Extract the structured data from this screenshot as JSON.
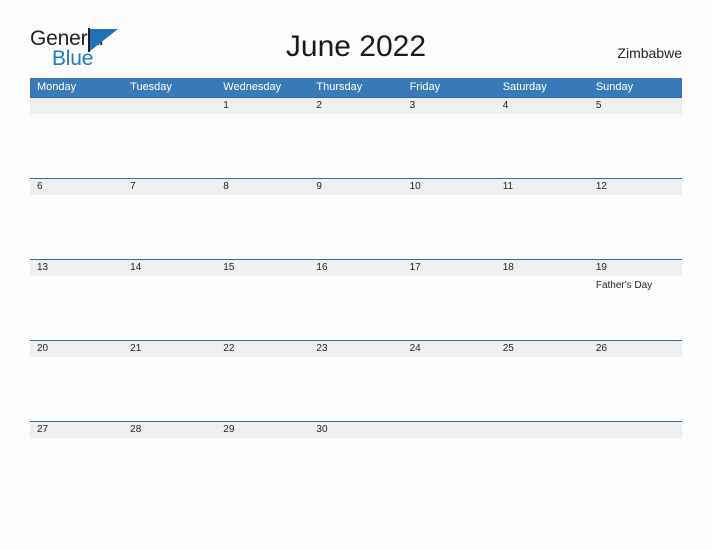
{
  "brand": {
    "name_part1": "General",
    "name_part2": "Blue",
    "triangle_color": "#2071b5",
    "blue_color": "#1f7bc1"
  },
  "header": {
    "title": "June 2022",
    "country": "Zimbabwe"
  },
  "theme": {
    "header_blue": "#3a7ab8",
    "band_gray": "#efefef",
    "band_border": "#2e6da4",
    "page_background": "#fcfcfc",
    "text_color": "#231f20"
  },
  "calendar": {
    "weekdays": [
      "Monday",
      "Tuesday",
      "Wednesday",
      "Thursday",
      "Friday",
      "Saturday",
      "Sunday"
    ],
    "weeks": [
      {
        "days": [
          {
            "date": "",
            "event": ""
          },
          {
            "date": "",
            "event": ""
          },
          {
            "date": "1",
            "event": ""
          },
          {
            "date": "2",
            "event": ""
          },
          {
            "date": "3",
            "event": ""
          },
          {
            "date": "4",
            "event": ""
          },
          {
            "date": "5",
            "event": ""
          }
        ]
      },
      {
        "days": [
          {
            "date": "6",
            "event": ""
          },
          {
            "date": "7",
            "event": ""
          },
          {
            "date": "8",
            "event": ""
          },
          {
            "date": "9",
            "event": ""
          },
          {
            "date": "10",
            "event": ""
          },
          {
            "date": "11",
            "event": ""
          },
          {
            "date": "12",
            "event": ""
          }
        ]
      },
      {
        "days": [
          {
            "date": "13",
            "event": ""
          },
          {
            "date": "14",
            "event": ""
          },
          {
            "date": "15",
            "event": ""
          },
          {
            "date": "16",
            "event": ""
          },
          {
            "date": "17",
            "event": ""
          },
          {
            "date": "18",
            "event": ""
          },
          {
            "date": "19",
            "event": "Father's Day"
          }
        ]
      },
      {
        "days": [
          {
            "date": "20",
            "event": ""
          },
          {
            "date": "21",
            "event": ""
          },
          {
            "date": "22",
            "event": ""
          },
          {
            "date": "23",
            "event": ""
          },
          {
            "date": "24",
            "event": ""
          },
          {
            "date": "25",
            "event": ""
          },
          {
            "date": "26",
            "event": ""
          }
        ]
      },
      {
        "days": [
          {
            "date": "27",
            "event": ""
          },
          {
            "date": "28",
            "event": ""
          },
          {
            "date": "29",
            "event": ""
          },
          {
            "date": "30",
            "event": ""
          },
          {
            "date": "",
            "event": ""
          },
          {
            "date": "",
            "event": ""
          },
          {
            "date": "",
            "event": ""
          }
        ]
      }
    ]
  }
}
